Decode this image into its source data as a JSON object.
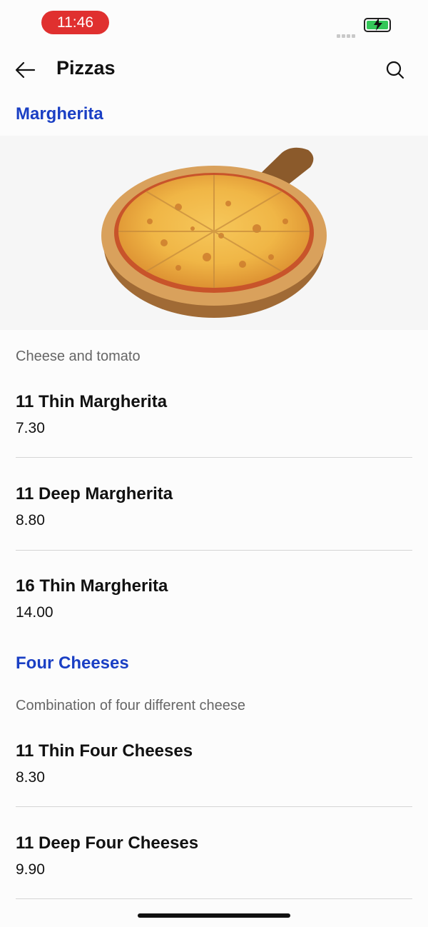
{
  "status": {
    "time": "11:46"
  },
  "header": {
    "title": "Pizzas"
  },
  "sections": [
    {
      "title": "Margherita",
      "description": "Cheese and tomato",
      "items": [
        {
          "name": "11 Thin Margherita",
          "price": "7.30"
        },
        {
          "name": "11 Deep Margherita",
          "price": "8.80"
        },
        {
          "name": "16 Thin Margherita",
          "price": "14.00"
        }
      ]
    },
    {
      "title": "Four Cheeses",
      "description": "Combination of four different cheese",
      "items": [
        {
          "name": "11 Thin Four Cheeses",
          "price": "8.30"
        },
        {
          "name": "11 Deep Four Cheeses",
          "price": "9.90"
        }
      ]
    }
  ],
  "colors": {
    "accent": "#1a3fc4",
    "time_pill": "#e0302f",
    "battery": "#34c759"
  },
  "icons": {
    "back": "arrow-left-icon",
    "search": "search-icon",
    "battery": "battery-charging-icon"
  }
}
